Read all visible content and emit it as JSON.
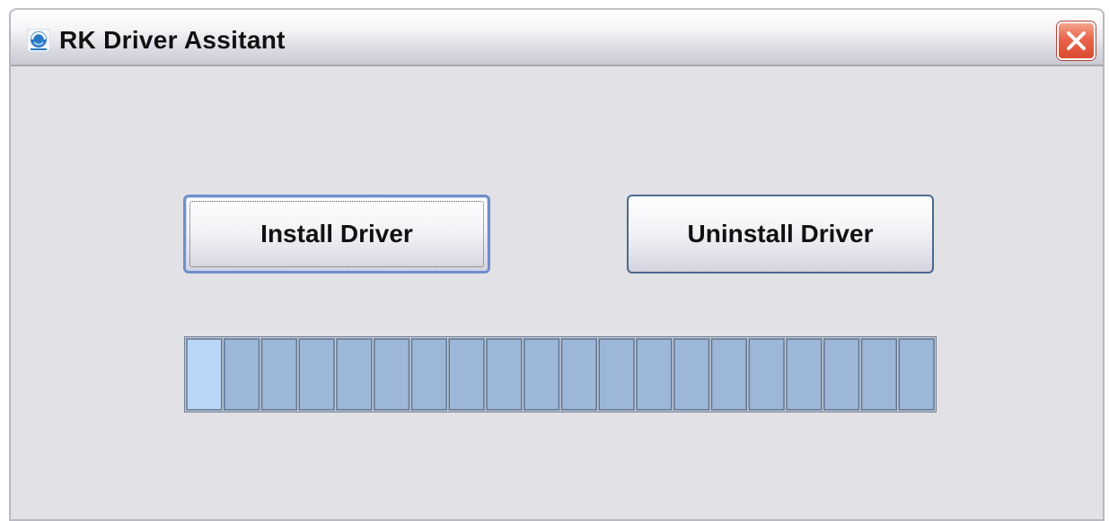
{
  "window": {
    "title": "RK Driver Assitant"
  },
  "icons": {
    "app": "app-logo-icon",
    "close": "close-icon"
  },
  "buttons": {
    "install_label": "Install Driver",
    "uninstall_label": "Uninstall Driver"
  },
  "progress": {
    "segments_total": 20,
    "active_segment": 1,
    "colors": {
      "segment": "#9cb7d7",
      "active_segment": "#b9d6f6",
      "border": "#5f7691"
    }
  },
  "colors": {
    "window_bg": "#e2e1e5",
    "close_button": "#e0563b"
  }
}
